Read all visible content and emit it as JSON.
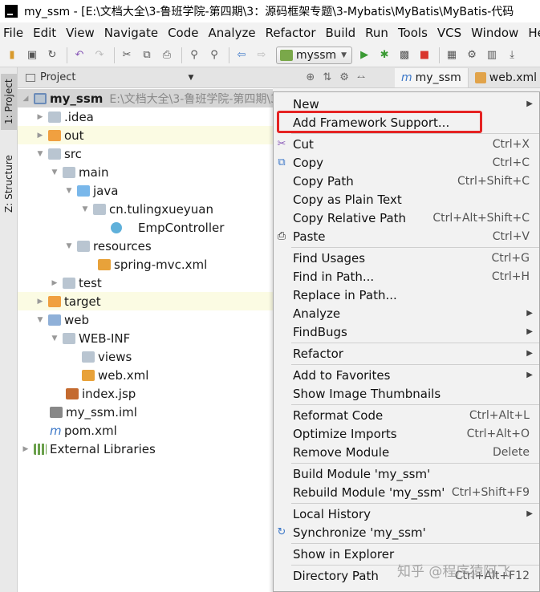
{
  "titlebar": {
    "title": "my_ssm - [E:\\文档大全\\3-鲁班学院-第四期\\3：源码框架专题\\3-Mybatis\\MyBatis\\MyBatis-代码"
  },
  "menubar": [
    "File",
    "Edit",
    "View",
    "Navigate",
    "Code",
    "Analyze",
    "Refactor",
    "Build",
    "Run",
    "Tools",
    "VCS",
    "Window",
    "Help"
  ],
  "toolbar": {
    "run_config": "myssm"
  },
  "leftstrip": {
    "project_tab": "1: Project",
    "structure_tab": "Z: Structure"
  },
  "project_panel": {
    "header": "Project"
  },
  "editor_tabs": [
    "my_ssm",
    "web.xml"
  ],
  "tree": [
    {
      "label": "my_ssm",
      "path": "E:\\文档大全\\3-鲁班学院-第四期\\3"
    },
    {
      "label": ".idea"
    },
    {
      "label": "out"
    },
    {
      "label": "src"
    },
    {
      "label": "main"
    },
    {
      "label": "java"
    },
    {
      "label": "cn.tulingxueyuan"
    },
    {
      "label": "EmpController"
    },
    {
      "label": "resources"
    },
    {
      "label": "spring-mvc.xml"
    },
    {
      "label": "test"
    },
    {
      "label": "target"
    },
    {
      "label": "web"
    },
    {
      "label": "WEB-INF"
    },
    {
      "label": "views"
    },
    {
      "label": "web.xml"
    },
    {
      "label": "index.jsp"
    },
    {
      "label": "my_ssm.iml"
    },
    {
      "label": "pom.xml"
    },
    {
      "label": "External Libraries"
    }
  ],
  "context_menu": [
    {
      "label": "New",
      "shortcut": ""
    },
    {
      "label": "Add Framework Support...",
      "shortcut": ""
    },
    {
      "label": "Cut",
      "shortcut": "Ctrl+X"
    },
    {
      "label": "Copy",
      "shortcut": "Ctrl+C"
    },
    {
      "label": "Copy Path",
      "shortcut": "Ctrl+Shift+C"
    },
    {
      "label": "Copy as Plain Text",
      "shortcut": ""
    },
    {
      "label": "Copy Relative Path",
      "shortcut": "Ctrl+Alt+Shift+C"
    },
    {
      "label": "Paste",
      "shortcut": "Ctrl+V"
    },
    {
      "label": "Find Usages",
      "shortcut": "Ctrl+G"
    },
    {
      "label": "Find in Path...",
      "shortcut": "Ctrl+H"
    },
    {
      "label": "Replace in Path...",
      "shortcut": ""
    },
    {
      "label": "Analyze",
      "shortcut": ""
    },
    {
      "label": "FindBugs",
      "shortcut": ""
    },
    {
      "label": "Refactor",
      "shortcut": ""
    },
    {
      "label": "Add to Favorites",
      "shortcut": ""
    },
    {
      "label": "Show Image Thumbnails",
      "shortcut": ""
    },
    {
      "label": "Reformat Code",
      "shortcut": "Ctrl+Alt+L"
    },
    {
      "label": "Optimize Imports",
      "shortcut": "Ctrl+Alt+O"
    },
    {
      "label": "Remove Module",
      "shortcut": "Delete"
    },
    {
      "label": "Build Module 'my_ssm'",
      "shortcut": ""
    },
    {
      "label": "Rebuild Module 'my_ssm'",
      "shortcut": "Ctrl+Shift+F9"
    },
    {
      "label": "Local History",
      "shortcut": ""
    },
    {
      "label": "Synchronize 'my_ssm'",
      "shortcut": ""
    },
    {
      "label": "Show in Explorer",
      "shortcut": ""
    },
    {
      "label": "Directory Path",
      "shortcut": "Ctrl+Alt+F12"
    }
  ],
  "watermark": "知乎 @程序猿阿飞"
}
